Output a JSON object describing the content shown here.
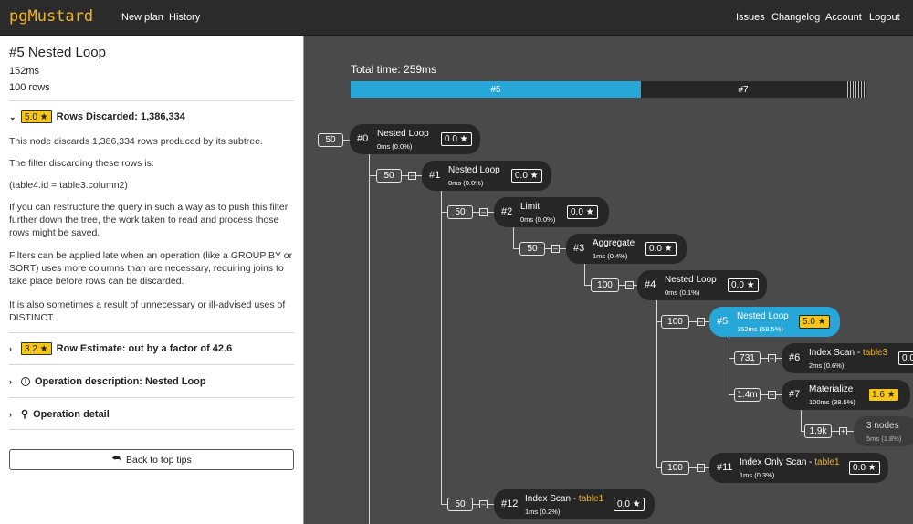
{
  "nav": {
    "logo": "pgMustard",
    "new_plan": "New plan",
    "history": "History",
    "issues": "Issues",
    "changelog": "Changelog",
    "account": "Account",
    "logout": "Logout"
  },
  "panel": {
    "title": "#5 Nested Loop",
    "time": "152ms",
    "rows": "100 rows",
    "rows_discarded": {
      "score": "5.0 ★",
      "label": "Rows Discarded: 1,386,334",
      "p1": "This node discards 1,386,334 rows produced by its subtree.",
      "p2": "The filter discarding these rows is:",
      "p3": "(table4.id = table3.column2)",
      "p4": "If you can restructure the query in such a way as to push this filter further down the tree, the work taken to read and process those rows might be saved.",
      "p5": "Filters can be applied late when an operation (like a GROUP BY or SORT) uses more columns than are necessary, requiring joins to take place before rows can be discarded.",
      "p6": "It is also sometimes a result of unnecessary or ill-advised uses of DISTINCT."
    },
    "row_estimate": {
      "score": "3.2 ★",
      "label": "Row Estimate: out by a factor of 42.6"
    },
    "op_description": "Operation description: Nested Loop",
    "op_detail": "Operation detail",
    "back_button": "Back to top tips"
  },
  "timeline": {
    "total": "Total time: 259ms",
    "seg_a": "#5",
    "seg_b": "#7",
    "seg_a_fraction": 0.587,
    "colors": {
      "selected": "#27a6d8",
      "dark": "#262626",
      "star": "#f5c518"
    }
  },
  "nodes": [
    {
      "id": "#0",
      "name": "Nested Loop",
      "table": "",
      "time": "0ms (0.0%)",
      "score": "0.0 ★",
      "count": "50"
    },
    {
      "id": "#1",
      "name": "Nested Loop",
      "table": "",
      "time": "0ms (0.0%)",
      "score": "0.0 ★",
      "count": "50"
    },
    {
      "id": "#2",
      "name": "Limit",
      "table": "",
      "time": "0ms (0.0%)",
      "score": "0.0 ★",
      "count": "50"
    },
    {
      "id": "#3",
      "name": "Aggregate",
      "table": "",
      "time": "1ms (0.4%)",
      "score": "0.0 ★",
      "count": "50"
    },
    {
      "id": "#4",
      "name": "Nested Loop",
      "table": "",
      "time": "0ms (0.1%)",
      "score": "0.0 ★",
      "count": "100"
    },
    {
      "id": "#5",
      "name": "Nested Loop",
      "table": "",
      "time": "152ms (58.5%)",
      "score": "5.0 ★",
      "count": "100"
    },
    {
      "id": "#6",
      "name": "Index Scan - ",
      "table": "table3",
      "time": "2ms (0.6%)",
      "score": "0.0",
      "count": "731"
    },
    {
      "id": "#7",
      "name": "Materialize",
      "table": "",
      "time": "100ms (38.5%)",
      "score": "1.6 ★",
      "count": "1.4m"
    },
    {
      "id": "",
      "name": "3 nodes",
      "table": "",
      "time": "5ms (1.8%)",
      "score": "",
      "count": "1.9k"
    },
    {
      "id": "#11",
      "name": "Index Only Scan - ",
      "table": "table1",
      "time": "1ms (0.3%)",
      "score": "0.0 ★",
      "count": "100"
    },
    {
      "id": "#12",
      "name": "Index Scan - ",
      "table": "table1",
      "time": "1ms (0.2%)",
      "score": "0.0 ★",
      "count": "50"
    }
  ]
}
